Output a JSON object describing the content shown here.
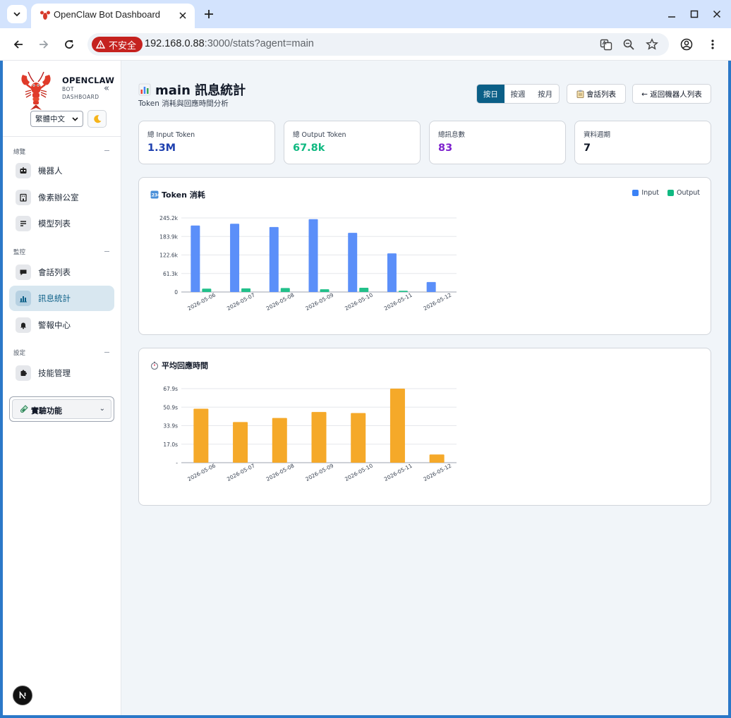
{
  "browser": {
    "tab_title": "OpenClaw Bot Dashboard",
    "security_label": "不安全",
    "url_host": "192.168.0.88",
    "url_path": ":3000/stats?agent=main"
  },
  "sidebar": {
    "brand": "OPENCLAW",
    "brand_sub": "BOT DASHBOARD",
    "language": "繁體中文",
    "sections": [
      {
        "label": "總覽",
        "items": [
          {
            "label": "機器人"
          },
          {
            "label": "像素辦公室"
          },
          {
            "label": "模型列表"
          }
        ]
      },
      {
        "label": "監控",
        "items": [
          {
            "label": "會話列表"
          },
          {
            "label": "訊息統計",
            "active": true
          },
          {
            "label": "警報中心"
          }
        ]
      },
      {
        "label": "設定",
        "items": [
          {
            "label": "技能管理"
          }
        ]
      }
    ],
    "experimental_label": "實驗功能"
  },
  "header": {
    "title": "main 訊息統計",
    "subtitle": "Token 消耗與回應時間分析",
    "period_tabs": [
      {
        "label": "按日",
        "active": true
      },
      {
        "label": "按週"
      },
      {
        "label": "按月"
      }
    ],
    "sessions_button": "會話列表",
    "back_button": "← 返回機器人列表"
  },
  "stats": [
    {
      "label": "總 Input Token",
      "value": "1.3M",
      "color": "#1e40af"
    },
    {
      "label": "總 Output Token",
      "value": "67.8k",
      "color": "#10b981"
    },
    {
      "label": "總訊息數",
      "value": "83",
      "color": "#7e22ce"
    },
    {
      "label": "資料週期",
      "value": "7",
      "color": "#111827"
    }
  ],
  "chart_data": [
    {
      "type": "bar",
      "title": "Token 消耗",
      "categories": [
        "2026-05-06",
        "2026-05-07",
        "2026-05-08",
        "2026-05-09",
        "2026-05-10",
        "2026-05-11",
        "2026-05-12"
      ],
      "series": [
        {
          "name": "Input",
          "color": "#5b8ff9",
          "values": [
            220000,
            226000,
            215000,
            241000,
            196000,
            128000,
            33000
          ]
        },
        {
          "name": "Output",
          "color": "#22c08a",
          "values": [
            11000,
            12000,
            13000,
            9000,
            14000,
            4000,
            0
          ]
        }
      ],
      "yticks": [
        "245.2k",
        "183.9k",
        "122.6k",
        "61.3k",
        "0"
      ],
      "ylim": [
        0,
        245200
      ],
      "grid": true,
      "legend": "top-right"
    },
    {
      "type": "bar",
      "title": "平均回應時間",
      "categories": [
        "2026-05-06",
        "2026-05-07",
        "2026-05-08",
        "2026-05-09",
        "2026-05-10",
        "2026-05-11",
        "2026-05-12"
      ],
      "series": [
        {
          "name": "",
          "color": "#f5a929",
          "values": [
            49.5,
            37.3,
            41.0,
            46.5,
            45.5,
            67.9,
            7.5
          ]
        }
      ],
      "yticks": [
        "67.9s",
        "50.9s",
        "33.9s",
        "17.0s",
        "-"
      ],
      "ylim": [
        0,
        67.9
      ],
      "grid": true
    }
  ]
}
